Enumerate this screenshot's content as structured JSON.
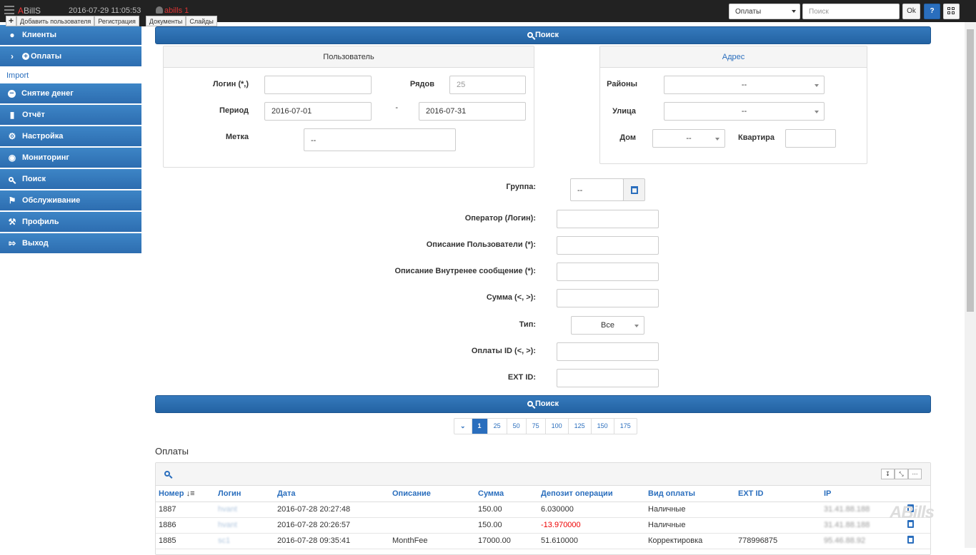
{
  "topbar": {
    "brand_a": "A",
    "brand_rest": "BillS",
    "datetime": "2016-07-29 11:05:53",
    "user": "abills 1",
    "module_select": "Оплаты",
    "search_placeholder": "Поиск",
    "ok_label": "Ok",
    "help_label": "?"
  },
  "quick_links": [
    "+",
    "Добавить пользователя",
    "Регистрация",
    "",
    "Документы",
    "Слайды"
  ],
  "sidebar": {
    "items": [
      {
        "label": "Клиенты",
        "icon": "user-icon"
      },
      {
        "label": "Оплаты",
        "icon": "plus-circle-icon"
      },
      {
        "label": "Import",
        "icon": ""
      },
      {
        "label": "Снятие денег",
        "icon": "minus-circle-icon"
      },
      {
        "label": "Отчёт",
        "icon": "bar-chart-icon"
      },
      {
        "label": "Настройка",
        "icon": "gear-icon"
      },
      {
        "label": "Мониторинг",
        "icon": "eye-icon"
      },
      {
        "label": "Поиск",
        "icon": "search-icon"
      },
      {
        "label": "Обслуживание",
        "icon": "flag-icon"
      },
      {
        "label": "Профиль",
        "icon": "wrench-icon"
      },
      {
        "label": "Выход",
        "icon": "logout-icon"
      }
    ]
  },
  "search_button": "Поиск",
  "user_panel": {
    "title": "Пользователь",
    "login_label": "Логин (*,)",
    "login_value": "",
    "rows_label": "Рядов",
    "rows_value": "25",
    "period_label": "Период",
    "period_from": "2016-07-01",
    "period_sep": "-",
    "period_to": "2016-07-31",
    "tag_label": "Метка",
    "tag_value": "--"
  },
  "address_panel": {
    "title": "Адрес",
    "districts_label": "Районы",
    "districts_value": "--",
    "street_label": "Улица",
    "street_value": "--",
    "house_label": "Дом",
    "house_value": "--",
    "flat_label": "Квартира",
    "flat_value": ""
  },
  "filters": {
    "group_label": "Группа:",
    "group_value": "--",
    "operator_label": "Оператор (Логин):",
    "user_desc_label": "Описание Пользователи (*):",
    "internal_desc_label": "Описание Внутренее сообщение (*):",
    "sum_label": "Сумма (<, >):",
    "type_label": "Тип:",
    "type_value": "Все",
    "payment_id_label": "Оплаты ID (<, >):",
    "ext_id_label": "EXT ID:"
  },
  "pager": [
    "1",
    "25",
    "50",
    "75",
    "100",
    "125",
    "150",
    "175"
  ],
  "table": {
    "title": "Оплаты",
    "columns": [
      "Номер",
      "Логин",
      "Дата",
      "Описание",
      "Сумма",
      "Депозит операции",
      "Вид оплаты",
      "EXT ID",
      "IP"
    ],
    "rows": [
      {
        "id": "1887",
        "login": "hvant",
        "date": "2016-07-28 20:27:48",
        "desc": "",
        "sum": "150.00",
        "deposit": "6.030000",
        "deposit_neg": false,
        "type": "Наличные",
        "ext": "",
        "ip": "31.41.88.188"
      },
      {
        "id": "1886",
        "login": "hvant",
        "date": "2016-07-28 20:26:57",
        "desc": "",
        "sum": "150.00",
        "deposit": "-13.970000",
        "deposit_neg": true,
        "type": "Наличные",
        "ext": "",
        "ip": "31.41.88.188"
      },
      {
        "id": "1885",
        "login": "sc1",
        "date": "2016-07-28 09:35:41",
        "desc": "MonthFee",
        "sum": "17000.00",
        "deposit": "51.610000",
        "deposit_neg": false,
        "type": "Корректировка",
        "ext": "778996875",
        "ip": "95.46.88.92"
      }
    ]
  },
  "colors": {
    "accent": "#2a6ebd",
    "topbar": "#222222",
    "negative": "#e00000"
  }
}
